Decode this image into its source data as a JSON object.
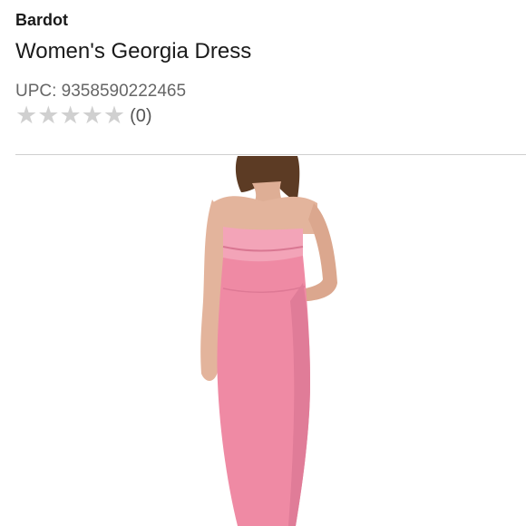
{
  "product": {
    "brand": "Bardot",
    "title": "Women's Georgia Dress",
    "upc_text": "UPC: 9358590222465",
    "rating": {
      "stars_filled": 0,
      "stars_total": 5,
      "count_text": "(0)"
    }
  },
  "colors": {
    "dress_pink": "#ef8aa4",
    "skin": "#e3b49c",
    "hair": "#5c3b24",
    "star_empty": "#d0d0d0"
  }
}
